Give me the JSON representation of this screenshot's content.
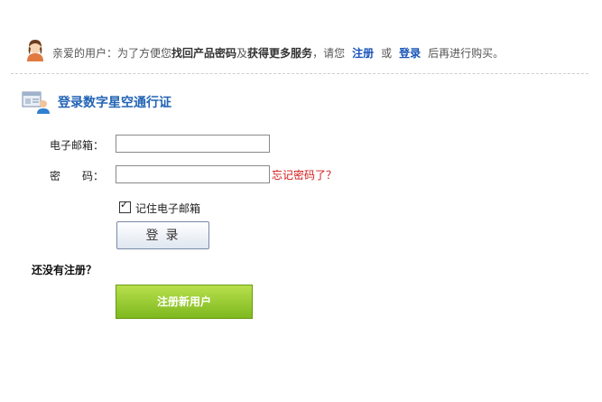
{
  "notice": {
    "text_prefix": "亲爱的用户：为了方便您",
    "bold_1": "找回产品密码",
    "text_mid": "及",
    "bold_2": "获得更多服务",
    "text_after": "，请您",
    "register_link": "注册",
    "or_text": "或",
    "login_link": "登录",
    "text_suffix": "后再进行购买。"
  },
  "section": {
    "title": "登录数字星空通行证"
  },
  "form": {
    "email_label": "电子邮箱：",
    "email_value": "",
    "password_label": "密　　码：",
    "password_value": "",
    "forgot_link": "忘记密码了？",
    "remember_label": "记住电子邮箱",
    "remember_checked": true,
    "login_button": "登录"
  },
  "register": {
    "prompt": "还没有注册？",
    "button": "注册新用户"
  },
  "colors": {
    "link_blue": "#1a55b8",
    "title_blue": "#2364b4",
    "forgot_red": "#d31a1a",
    "green_button": "#7eb81e"
  }
}
